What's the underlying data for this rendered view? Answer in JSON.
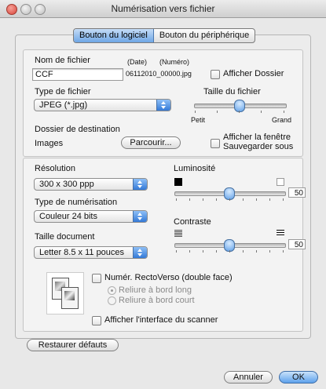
{
  "window": {
    "title": "Numérisation vers fichier"
  },
  "tabs": [
    "Bouton du logiciel",
    "Bouton du périphérique"
  ],
  "file": {
    "name_label": "Nom de fichier",
    "date_label": "(Date)",
    "number_label": "(Numéro)",
    "name_value": "CCF",
    "preview": "06112010_00000.jpg",
    "show_folder_label": "Afficher Dossier"
  },
  "file_type": {
    "label": "Type de fichier",
    "value": "JPEG (*.jpg)"
  },
  "file_size": {
    "label": "Taille du fichier",
    "min_label": "Petit",
    "max_label": "Grand",
    "level": 0.5
  },
  "destination": {
    "label": "Dossier de destination",
    "value": "Images",
    "browse_label": "Parcourir...",
    "show_save_as_label_1": "Afficher la fenêtre",
    "show_save_as_label_2": "Sauvegarder sous"
  },
  "resolution": {
    "label": "Résolution",
    "value": "300 x 300 ppp"
  },
  "scan_type": {
    "label": "Type de numérisation",
    "value": "Couleur 24 bits"
  },
  "document_size": {
    "label": "Taille document",
    "value": "Letter  8.5 x 11 pouces"
  },
  "brightness": {
    "label": "Luminosité",
    "value": "50",
    "level": 0.5
  },
  "contrast": {
    "label": "Contraste",
    "value": "50",
    "level": 0.5
  },
  "duplex": {
    "label": "Numér. RectoVerso (double face)",
    "long_edge_label": "Reliure à bord long",
    "short_edge_label": "Reliure à bord court"
  },
  "scanner_interface_label": "Afficher l'interface du scanner",
  "restore_label": "Restaurer défauts",
  "cancel_label": "Annuler",
  "ok_label": "OK",
  "colors": {
    "accent": "#5ea2ec",
    "window_bg": "#e8e8e8"
  }
}
